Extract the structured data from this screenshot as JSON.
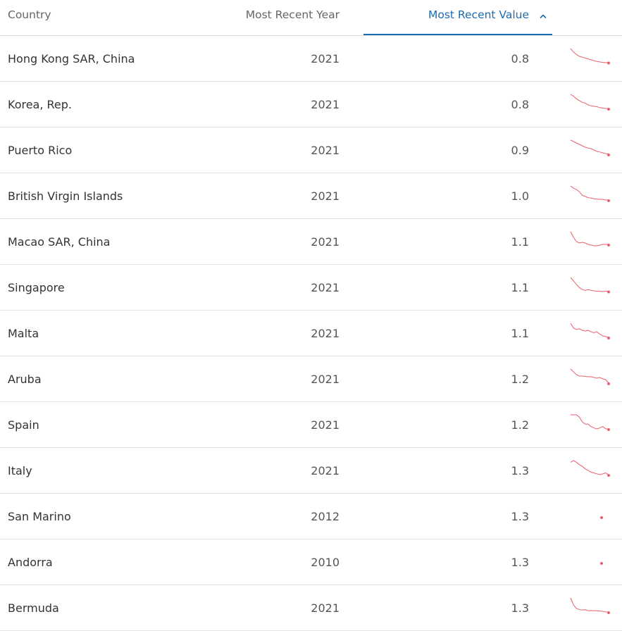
{
  "table": {
    "columns": {
      "country": "Country",
      "year": "Most Recent Year",
      "value": "Most Recent Value"
    },
    "sort": {
      "column": "value",
      "direction": "ascending",
      "icon": "chevron-up-icon"
    },
    "accent_color": "#1a6cb4",
    "sparkline_color": "#e8606a",
    "rows": [
      {
        "country": "Hong Kong SAR, China",
        "year": "2021",
        "value": "0.8",
        "trend": [
          1.6,
          1.4,
          1.25,
          1.15,
          1.1,
          1.05,
          1.0,
          0.95,
          0.9,
          0.85,
          0.82,
          0.8,
          0.78,
          0.8
        ]
      },
      {
        "country": "Korea, Rep.",
        "year": "2021",
        "value": "0.8",
        "trend": [
          1.6,
          1.5,
          1.35,
          1.25,
          1.15,
          1.1,
          1.0,
          0.95,
          0.92,
          0.9,
          0.85,
          0.82,
          0.8,
          0.8
        ]
      },
      {
        "country": "Puerto Rico",
        "year": "2021",
        "value": "0.9",
        "trend": [
          1.4,
          1.35,
          1.3,
          1.25,
          1.2,
          1.15,
          1.12,
          1.1,
          1.05,
          1.0,
          0.98,
          0.95,
          0.92,
          0.9
        ]
      },
      {
        "country": "British Virgin Islands",
        "year": "2021",
        "value": "1.0",
        "trend": [
          1.6,
          1.5,
          1.45,
          1.35,
          1.2,
          1.15,
          1.1,
          1.08,
          1.05,
          1.04,
          1.03,
          1.02,
          1.0,
          1.0
        ]
      },
      {
        "country": "Macao SAR, China",
        "year": "2021",
        "value": "1.1",
        "trend": [
          2.0,
          1.6,
          1.3,
          1.2,
          1.25,
          1.2,
          1.1,
          1.05,
          1.0,
          1.0,
          1.05,
          1.1,
          1.1,
          1.1
        ]
      },
      {
        "country": "Singapore",
        "year": "2021",
        "value": "1.1",
        "trend": [
          1.9,
          1.7,
          1.5,
          1.3,
          1.2,
          1.15,
          1.2,
          1.15,
          1.12,
          1.1,
          1.1,
          1.08,
          1.1,
          1.1
        ]
      },
      {
        "country": "Malta",
        "year": "2021",
        "value": "1.1",
        "trend": [
          2.0,
          1.7,
          1.6,
          1.65,
          1.55,
          1.5,
          1.55,
          1.45,
          1.4,
          1.45,
          1.3,
          1.2,
          1.15,
          1.1
        ]
      },
      {
        "country": "Aruba",
        "year": "2021",
        "value": "1.2",
        "trend": [
          2.2,
          2.0,
          1.8,
          1.7,
          1.7,
          1.68,
          1.65,
          1.65,
          1.6,
          1.55,
          1.6,
          1.5,
          1.45,
          1.2
        ]
      },
      {
        "country": "Spain",
        "year": "2021",
        "value": "1.2",
        "trend": [
          1.5,
          1.5,
          1.5,
          1.45,
          1.35,
          1.3,
          1.3,
          1.25,
          1.22,
          1.2,
          1.22,
          1.25,
          1.2,
          1.2
        ]
      },
      {
        "country": "Italy",
        "year": "2021",
        "value": "1.3",
        "trend": [
          1.45,
          1.47,
          1.45,
          1.42,
          1.4,
          1.37,
          1.35,
          1.33,
          1.32,
          1.31,
          1.3,
          1.31,
          1.32,
          1.3
        ]
      },
      {
        "country": "San Marino",
        "year": "2012",
        "value": "1.3",
        "trend": [
          1.3
        ]
      },
      {
        "country": "Andorra",
        "year": "2010",
        "value": "1.3",
        "trend": [
          1.3
        ]
      },
      {
        "country": "Bermuda",
        "year": "2021",
        "value": "1.3",
        "trend": [
          1.9,
          1.6,
          1.45,
          1.4,
          1.38,
          1.4,
          1.35,
          1.36,
          1.35,
          1.35,
          1.34,
          1.33,
          1.3,
          1.3
        ]
      }
    ]
  }
}
